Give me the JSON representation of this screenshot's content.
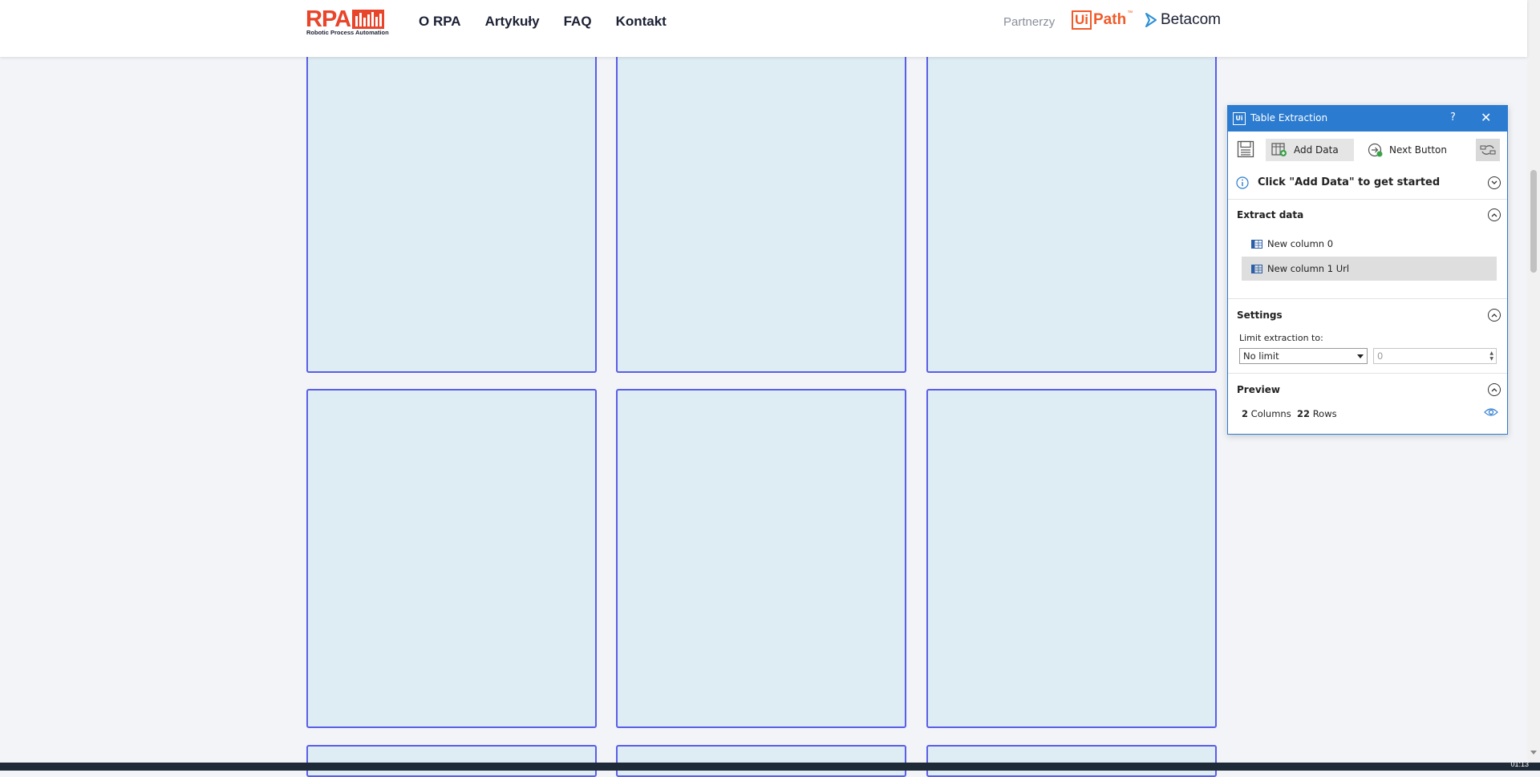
{
  "site": {
    "logo_text": "RPA",
    "logo_subtitle": "Robotic Process Automation",
    "nav": [
      "O RPA",
      "Artykuły",
      "FAQ",
      "Kontakt"
    ],
    "partners_label": "Partnerzy",
    "uipath_ui": "Ui",
    "uipath_path": "Path",
    "uipath_tm": "™",
    "betacom": "Betacom",
    "accent_color": "#e8452b"
  },
  "panel": {
    "title": "Table Extraction",
    "help": "?",
    "close": "✕",
    "toolbar": {
      "add_data": "Add Data",
      "next_button": "Next Button"
    },
    "hint": "Click \"Add Data\" to get started",
    "extract_section": "Extract data",
    "columns": [
      "New column 0",
      "New column 1 Url"
    ],
    "settings_section": "Settings",
    "limit_label": "Limit extraction to:",
    "limit_value": "No limit",
    "limit_number": "0",
    "preview_section": "Preview",
    "preview_columns_count": "2",
    "preview_columns_word": "Columns",
    "preview_rows_count": "22",
    "preview_rows_word": "Rows",
    "accent_color": "#2b7bd0"
  },
  "taskbar": {
    "clock": "01:13"
  }
}
